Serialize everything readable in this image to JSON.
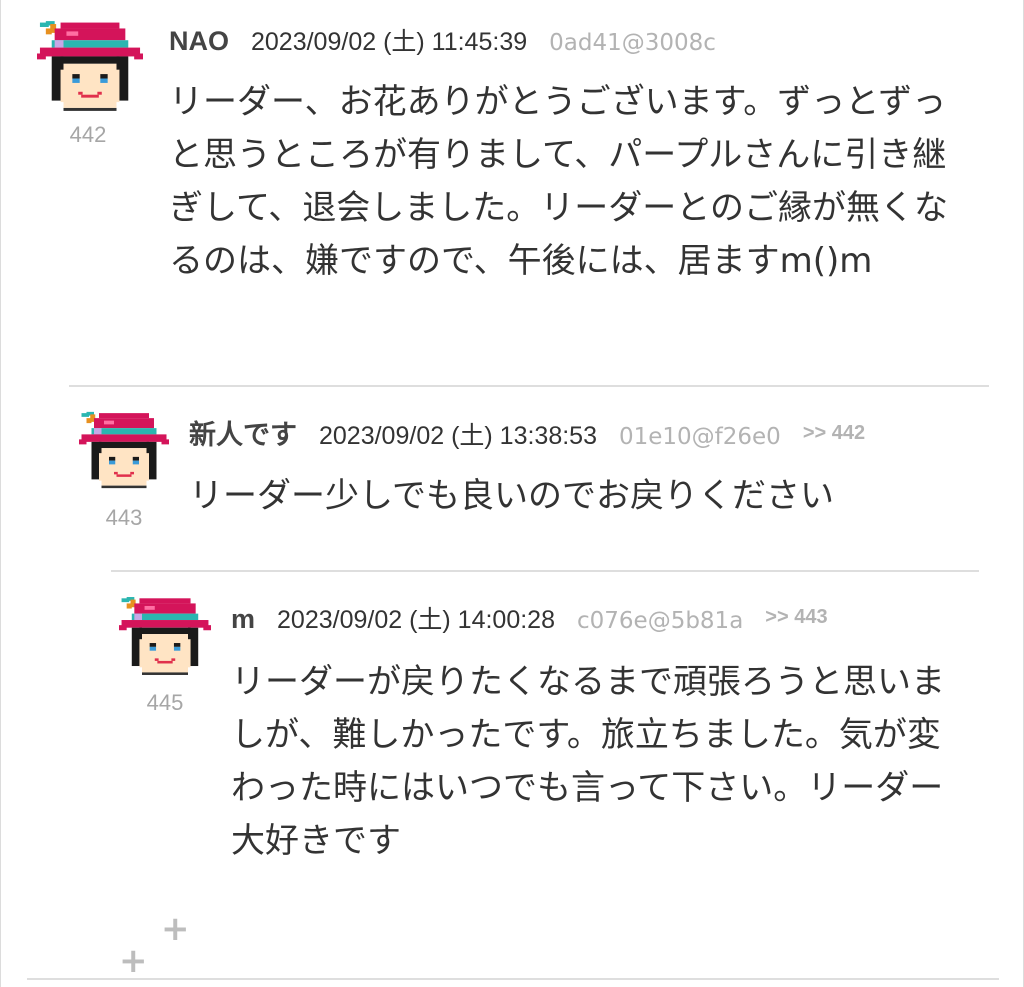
{
  "posts": [
    {
      "number": "442",
      "name": "NAO",
      "datetime": "2023/09/02 (土) 11:45:39",
      "user_id": "0ad41@3008c",
      "reply_to": "",
      "body": "リーダー、お花ありがとうございます。ずっとずっと思うところが有りまして、パープルさんに引き継ぎして、退会しました。リーダーとのご縁が無くなるのは、嫌ですので、午後には、居ますm()m"
    },
    {
      "number": "443",
      "name": "新人です",
      "datetime": "2023/09/02 (土) 13:38:53",
      "user_id": "01e10@f26e0",
      "reply_to": ">> 442",
      "body": "リーダー少しでも良いのでお戻りください"
    },
    {
      "number": "445",
      "name": "m",
      "datetime": "2023/09/02 (土) 14:00:28",
      "user_id": "c076e@5b81a",
      "reply_to": ">> 443",
      "body": "リーダーが戻りたくなるまで頑張ろうと思いましが、難しかったです。旅立ちました。気が変わった時にはいつでも言って下さい。リーダー大好きです"
    }
  ],
  "colors": {
    "hat": "#d4145a",
    "hat_band": "#2bb6b0",
    "hair": "#1a1a1a",
    "skin": "#ffe4c4",
    "divider": "#dedede",
    "muted_text": "#b3b3b3"
  },
  "icons": {
    "avatar": "pixel-avatar-hat",
    "expand": "plus-icon"
  }
}
